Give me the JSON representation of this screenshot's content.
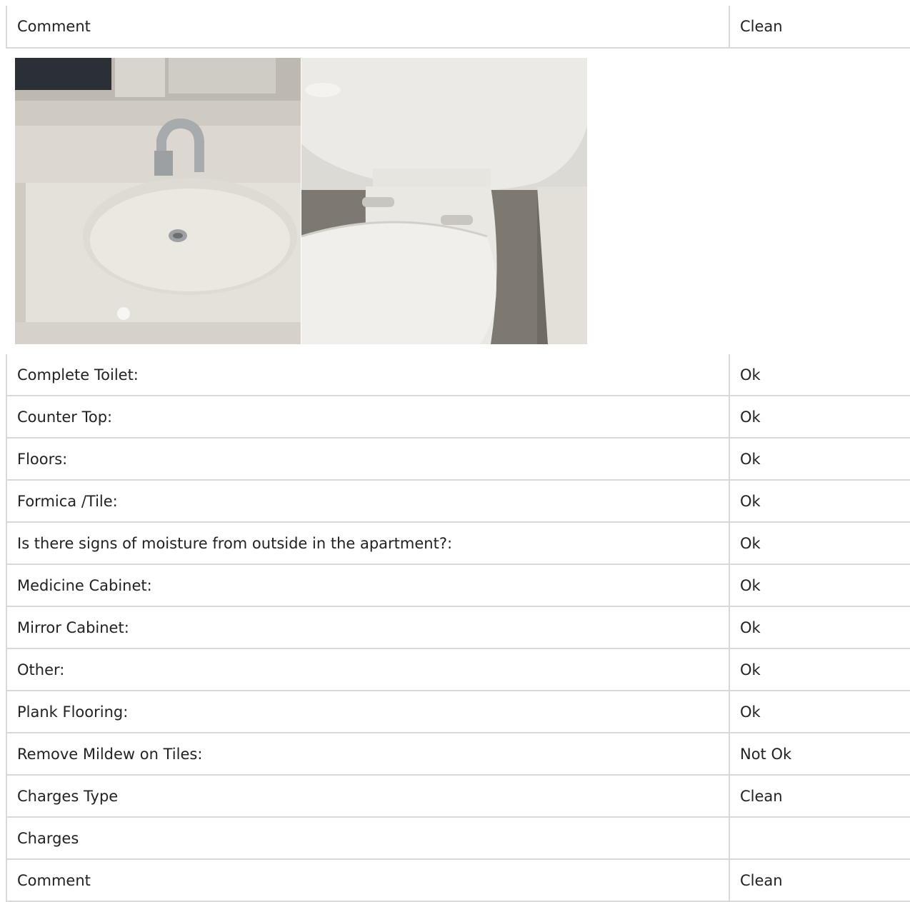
{
  "top": {
    "label": "Comment",
    "value": "Clean"
  },
  "photos": [
    {
      "icon": "sink-photo"
    },
    {
      "icon": "toilet-photo"
    }
  ],
  "rows": [
    {
      "label": "Complete Toilet:",
      "value": "Ok"
    },
    {
      "label": "Counter Top:",
      "value": "Ok"
    },
    {
      "label": "Floors:",
      "value": "Ok"
    },
    {
      "label": "Formica /Tile:",
      "value": "Ok"
    },
    {
      "label": "Is there signs of moisture from outside in the apartment?:",
      "value": "Ok"
    },
    {
      "label": "Medicine Cabinet:",
      "value": "Ok"
    },
    {
      "label": "Mirror Cabinet:",
      "value": "Ok"
    },
    {
      "label": "Other:",
      "value": "Ok"
    },
    {
      "label": "Plank Flooring:",
      "value": "Ok"
    },
    {
      "label": "Remove Mildew on Tiles:",
      "value": "Not Ok"
    },
    {
      "label": "Charges Type",
      "value": "Clean"
    },
    {
      "label": "Charges",
      "value": ""
    },
    {
      "label": "Comment",
      "value": "Clean"
    }
  ]
}
